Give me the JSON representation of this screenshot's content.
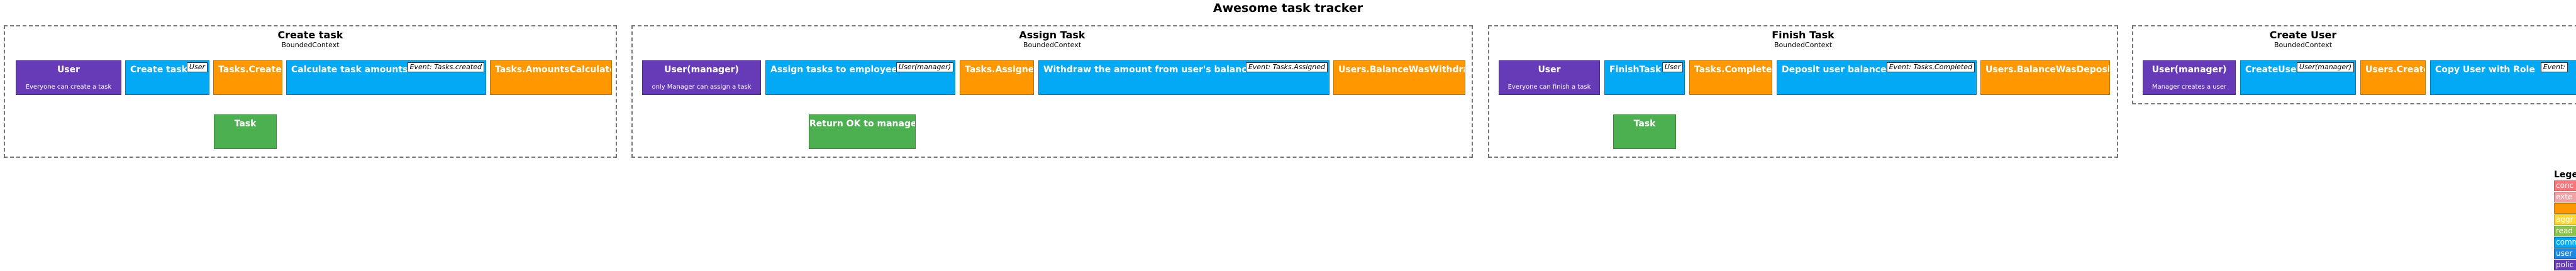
{
  "title": "Awesome task tracker",
  "contexts": [
    {
      "name": "Create task",
      "kind": "BoundedContext",
      "nodes": {
        "actor": {
          "label": "User",
          "note": "Everyone can create a task"
        },
        "command": {
          "label": "Create task",
          "tag": "User"
        },
        "event1": {
          "label": "Tasks.Created"
        },
        "policy": {
          "label": "Calculate task amounts",
          "tag": "Event: Tasks.created"
        },
        "event2": {
          "label": "Tasks.AmountsCalculated"
        },
        "readmodel": {
          "label": "Task"
        }
      }
    },
    {
      "name": "Assign Task",
      "kind": "BoundedContext",
      "nodes": {
        "actor": {
          "label": "User(manager)",
          "note": "only Manager can assign a task"
        },
        "command": {
          "label": "Assign tasks to employees",
          "tag": "User(manager)"
        },
        "event1": {
          "label": "Tasks.Assigned"
        },
        "policy": {
          "label": "Withdraw the amount from user's balance",
          "tag": "Event: Tasks.Assigned"
        },
        "event2": {
          "label": "Users.BalanceWasWithdrawn"
        },
        "readmodel": {
          "label": "Return OK to manager"
        }
      }
    },
    {
      "name": "Finish Task",
      "kind": "BoundedContext",
      "nodes": {
        "actor": {
          "label": "User",
          "note": "Everyone can finish a task"
        },
        "command": {
          "label": "FinishTask",
          "tag": "User"
        },
        "event1": {
          "label": "Tasks.Completed"
        },
        "policy": {
          "label": "Deposit user balance",
          "tag": "Event: Tasks.Completed"
        },
        "event2": {
          "label": "Users.BalanceWasDeposited"
        },
        "readmodel": {
          "label": "Task"
        }
      }
    },
    {
      "name": "Create User",
      "kind": "BoundedContext",
      "nodes": {
        "actor": {
          "label": "User(manager)",
          "note": "Manager creates a user"
        },
        "command": {
          "label": "CreateUser",
          "tag": "User(manager)"
        },
        "event1": {
          "label": "Users.Created"
        },
        "policy": {
          "label": "Copy User with Role",
          "tag": "Event:"
        }
      }
    }
  ],
  "legend": {
    "title": "Lege",
    "items": [
      {
        "label": "conc",
        "color": "#f8777d"
      },
      {
        "label": "exte",
        "color": "#f1a2a6"
      },
      {
        "label": "",
        "color": "#ff9800"
      },
      {
        "label": "aggr",
        "color": "#fdd835"
      },
      {
        "label": "read",
        "color": "#8bc34a"
      },
      {
        "label": "comm",
        "color": "#03a9f4"
      },
      {
        "label": "user",
        "color": "#1e88e5"
      },
      {
        "label": "polic",
        "color": "#673ab7"
      }
    ]
  }
}
